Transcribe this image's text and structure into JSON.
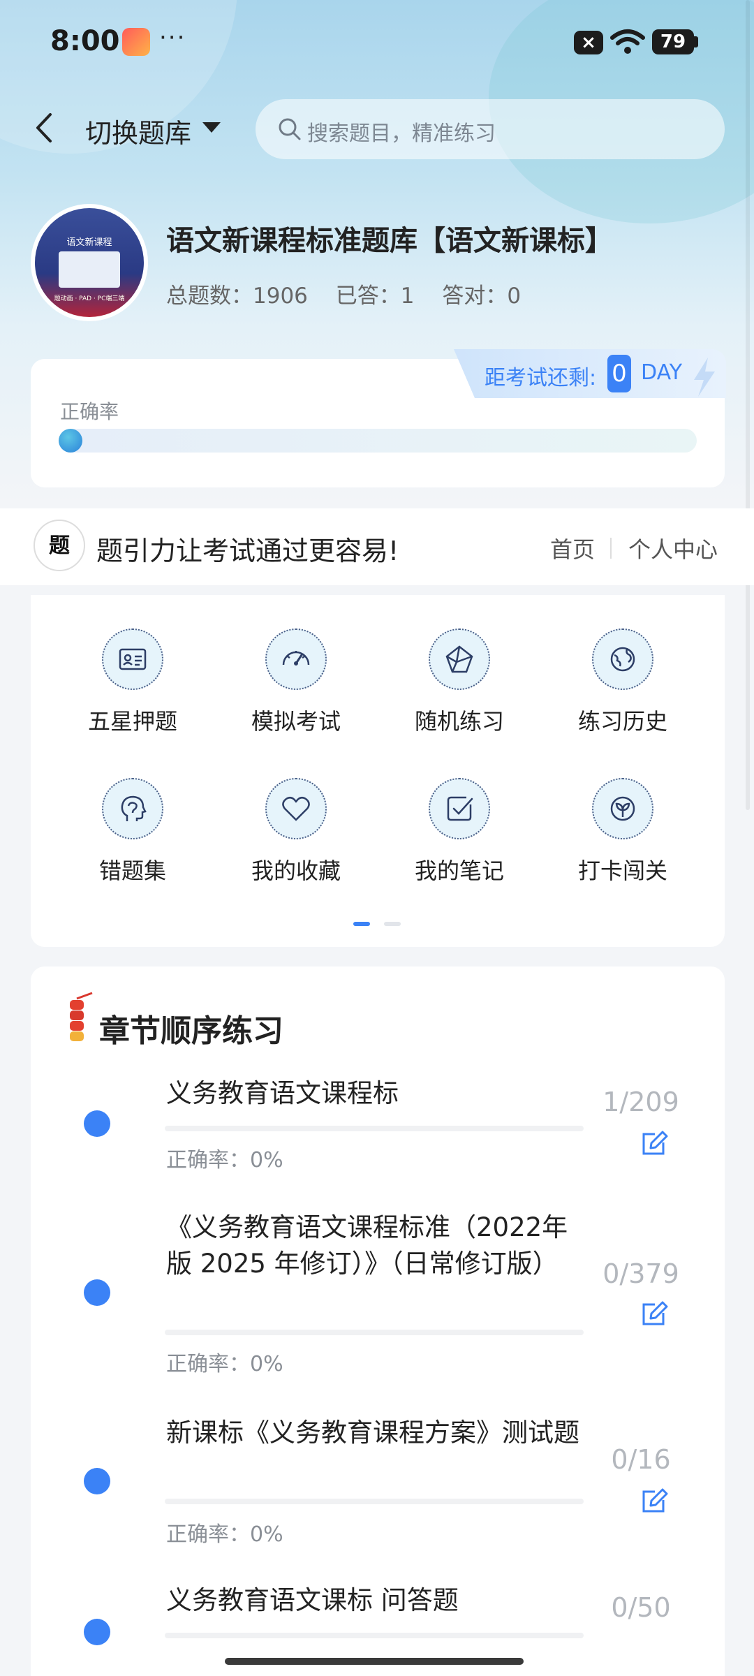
{
  "status_bar": {
    "time": "8:00",
    "dots": "···",
    "battery": "79"
  },
  "top_bar": {
    "switch_label": "切换题库",
    "search_placeholder": "搜索题目，精准练习"
  },
  "bank": {
    "title": "语文新课程标准题库【语文新课标】",
    "avatar_caption": "语文新课程",
    "avatar_strip": "题动画 · PAD · PC端三端",
    "total_label": "总题数：1906",
    "answered_label": "已答：1",
    "correct_label": "答对：0"
  },
  "accuracy": {
    "label": "正确率",
    "value": 0
  },
  "exam": {
    "label": "距考试还剩:",
    "days": "0",
    "unit": "DAY"
  },
  "brand": {
    "logo": "题",
    "slogan": "题引力让考试通过更容易!",
    "nav_home": "首页",
    "nav_center": "个人中心"
  },
  "features": [
    {
      "label": "五星押题",
      "icon": "id-card-icon"
    },
    {
      "label": "模拟考试",
      "icon": "speedometer-icon"
    },
    {
      "label": "随机练习",
      "icon": "random-icon"
    },
    {
      "label": "练习历史",
      "icon": "globe-icon"
    },
    {
      "label": "错题集",
      "icon": "head-icon"
    },
    {
      "label": "我的收藏",
      "icon": "heart-icon"
    },
    {
      "label": "我的笔记",
      "icon": "note-check-icon"
    },
    {
      "label": "打卡闯关",
      "icon": "sprout-icon"
    }
  ],
  "chapters": {
    "title": "章节顺序练习",
    "items": [
      {
        "name": "义务教育语文课程标",
        "accuracy": "正确率：0%",
        "count": "1/209"
      },
      {
        "name": "《义务教育语文课程标准（2022年版 2025 年修订）》（日常修订版）",
        "accuracy": "正确率：0%",
        "count": "0/379"
      },
      {
        "name": "新课标《义务教育课程方案》测试题",
        "accuracy": "正确率：0%",
        "count": "0/16"
      },
      {
        "name": "义务教育语文课标 问答题",
        "accuracy": "",
        "count": "0/50"
      }
    ]
  },
  "colors": {
    "accent": "#3b82f6",
    "hero_top": "#a9d5ec"
  }
}
